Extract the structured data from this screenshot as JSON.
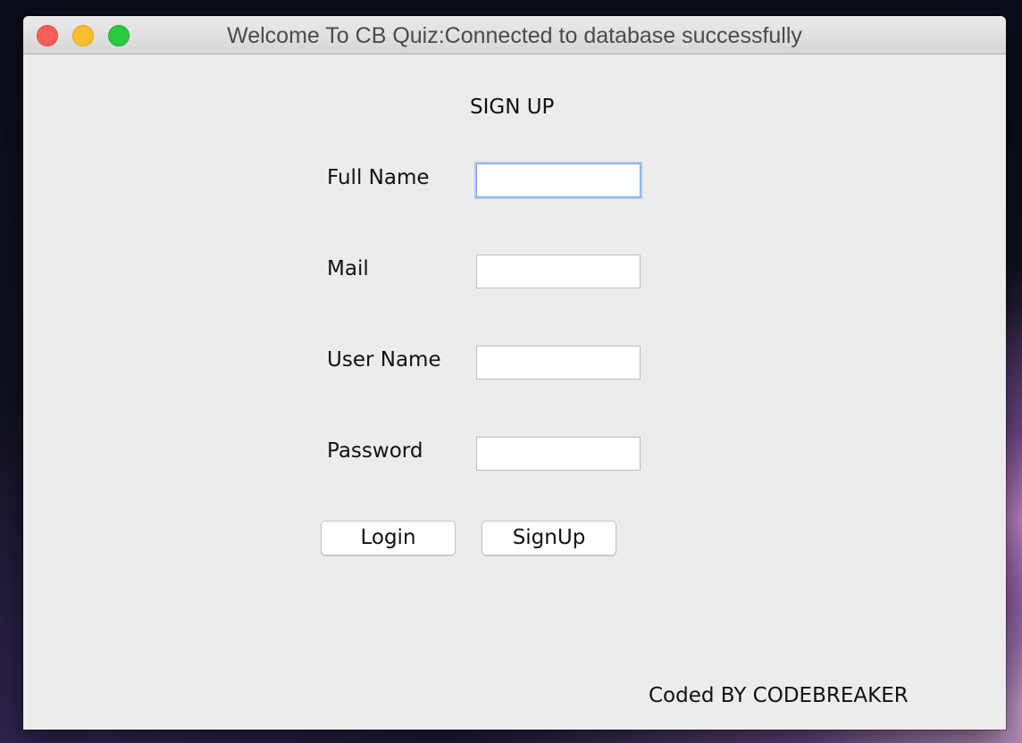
{
  "window": {
    "title": "Welcome To CB Quiz:Connected to database successfully"
  },
  "form": {
    "heading": "SIGN UP",
    "fields": [
      {
        "label": "Full Name",
        "value": "",
        "focused": true
      },
      {
        "label": "Mail",
        "value": ""
      },
      {
        "label": "User Name",
        "value": ""
      },
      {
        "label": "Password",
        "value": ""
      }
    ],
    "buttons": {
      "login_label": "Login",
      "signup_label": "SignUp"
    }
  },
  "footer": {
    "credit": "Coded BY CODEBREAKER"
  },
  "colors": {
    "close": "#fc5f57",
    "minimize": "#fdbc2e",
    "maximize": "#29c940",
    "focus_ring": "#6aa4e8"
  }
}
